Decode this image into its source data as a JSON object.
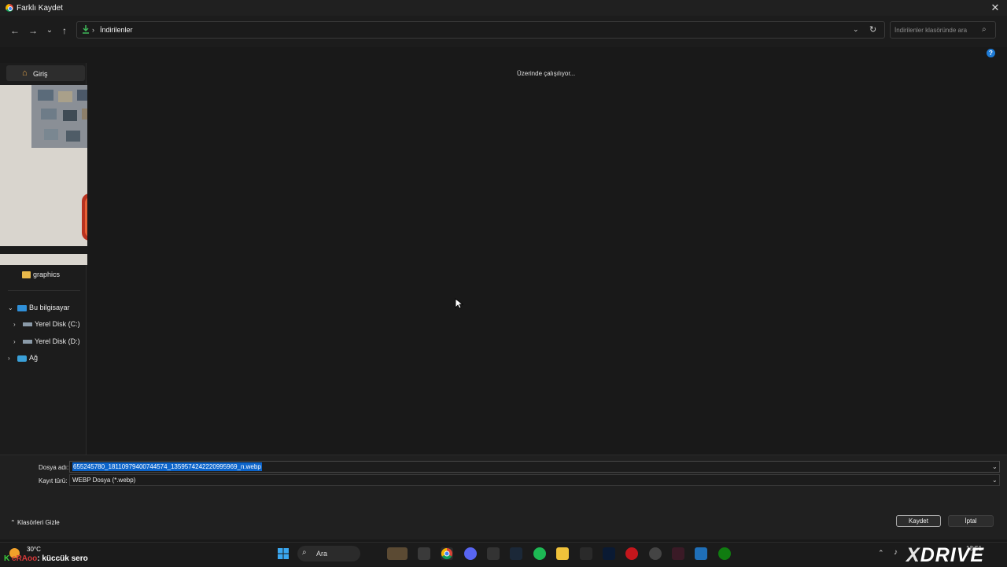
{
  "window": {
    "title": "Farklı Kaydet",
    "close_glyph": "✕"
  },
  "nav": {
    "back_glyph": "←",
    "forward_glyph": "→",
    "recent_glyph": "⌄",
    "up_glyph": "↑",
    "breadcrumb_sep": "›",
    "path": "İndirilenler",
    "dropdown_glyph": "⌄",
    "refresh_glyph": "↻",
    "search_placeholder": "İndirilenler klasöründe ara",
    "search_glyph": "⌕"
  },
  "help_glyph": "?",
  "sidebar": {
    "home": {
      "label": "Giriş",
      "icon": "home-icon"
    },
    "graphics": {
      "label": "graphics",
      "icon": "folder-icon"
    },
    "this_pc": {
      "label": "Bu bilgisayar",
      "icon": "computer-icon",
      "expanded": true
    },
    "disk_c": {
      "label": "Yerel Disk (C:)",
      "icon": "drive-icon"
    },
    "disk_d": {
      "label": "Yerel Disk (D:)",
      "icon": "drive-icon"
    },
    "network": {
      "label": "Ağ",
      "icon": "network-icon"
    }
  },
  "content": {
    "status": "Üzerinde çalışılıyor..."
  },
  "form": {
    "filename_label": "Dosya adı:",
    "filename_value": "655245780_18110979400744574_1359574242220995969_n.webp",
    "type_label": "Kayıt türü:",
    "type_value": "WEBP Dosya (*.webp)",
    "hide_folders_label": "Klasörleri Gizle",
    "save_label": "Kaydet",
    "cancel_label": "İptal"
  },
  "taskbar": {
    "temperature": "30°C",
    "chat_user": "cRAoo",
    "chat_message": ": küccük sero",
    "search_label": "Ara",
    "clock": "13:51"
  },
  "overlay": {
    "brand": "DRIVE",
    "brand_x": "X"
  },
  "colors": {
    "accent": "#0b63c9",
    "folder": "#e8b84a",
    "background": "#191919"
  }
}
